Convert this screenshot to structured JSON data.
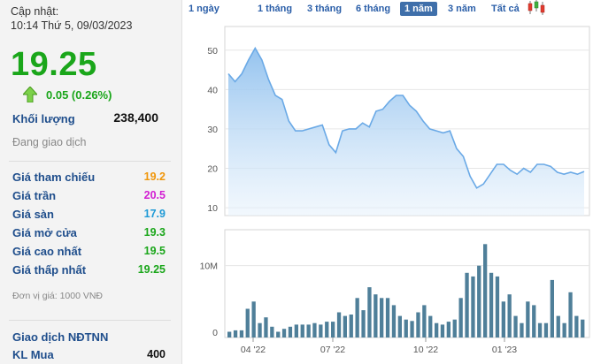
{
  "header": {
    "updated_label": "Cập nhật:",
    "updated_time": "10:14 Thứ 5, 09/03/2023",
    "price": "19.25",
    "change": "0.05 (0.26%)",
    "volume_label": "Khối lượng",
    "volume_value": "238,400",
    "status": "Đang giao dịch"
  },
  "stats": [
    {
      "label": "Giá tham chiếu",
      "value": "19.2",
      "color": "#f0960a"
    },
    {
      "label": "Giá trần",
      "value": "20.5",
      "color": "#d21fd2"
    },
    {
      "label": "Giá sàn",
      "value": "17.9",
      "color": "#1f9ad6"
    },
    {
      "label": "Giá mở cửa",
      "value": "19.3",
      "color": "#1aa61a"
    },
    {
      "label": "Giá cao nhất",
      "value": "19.5",
      "color": "#1aa61a"
    },
    {
      "label": "Giá thấp nhất",
      "value": "19.25",
      "color": "#1aa61a"
    }
  ],
  "unit_note": "Đơn vị giá: 1000 VNĐ",
  "foreign": {
    "title": "Giao dịch NĐTNN",
    "buy_label": "KL Mua",
    "buy_value": "400"
  },
  "tabs": [
    {
      "label": "1 ngày",
      "active": false
    },
    {
      "label": "1 tháng",
      "active": false
    },
    {
      "label": "3 tháng",
      "active": false
    },
    {
      "label": "6 tháng",
      "active": false
    },
    {
      "label": "1 năm",
      "active": true
    },
    {
      "label": "3 năm",
      "active": false
    },
    {
      "label": "Tất cả",
      "active": false
    }
  ],
  "colors": {
    "up": "#1aa61a",
    "label": "#1f4e8c",
    "line": "#6aa9e6",
    "bar": "#4f7f99",
    "tab_active": "#3f6faa"
  },
  "chart_data": [
    {
      "type": "area",
      "x_ticks": [
        "04 '22",
        "07 '22",
        "10 '22",
        "01 '23"
      ],
      "y_ticks": [
        "10",
        "20",
        "30",
        "40",
        "50"
      ],
      "ylim": [
        8,
        56
      ],
      "values": [
        44,
        42,
        44,
        47.5,
        50.5,
        47.5,
        42.5,
        38.5,
        37.5,
        32,
        29.5,
        29.5,
        30,
        30.5,
        31,
        26,
        24,
        29.5,
        30,
        30,
        31.5,
        30.5,
        34.5,
        35,
        37,
        38.5,
        38.5,
        36,
        34.5,
        32,
        30,
        29.5,
        29,
        29.5,
        25,
        23,
        18,
        15,
        16,
        18.5,
        21,
        21,
        19.5,
        18.5,
        20,
        19,
        21,
        21,
        20.5,
        19,
        18.5,
        19,
        18.5,
        19.2
      ]
    },
    {
      "type": "bar",
      "y_ticks": [
        "0",
        "10M"
      ],
      "ylim": [
        0,
        15
      ],
      "values": [
        0.8,
        1,
        1,
        4,
        5,
        2,
        2.8,
        1.5,
        0.8,
        1.2,
        1.5,
        1.8,
        1.8,
        1.8,
        2,
        1.8,
        2.2,
        2.2,
        3.5,
        3,
        3.2,
        5.5,
        3.8,
        7,
        6,
        5.5,
        5.5,
        4.5,
        3,
        2.5,
        2.3,
        3.5,
        4.5,
        3,
        2,
        1.8,
        2.2,
        2.5,
        5.5,
        9,
        8.5,
        10,
        13,
        9,
        8.5,
        5,
        6,
        3,
        2,
        5,
        4.5,
        2,
        2,
        8,
        3,
        2,
        6.3,
        3,
        2.5
      ]
    }
  ]
}
